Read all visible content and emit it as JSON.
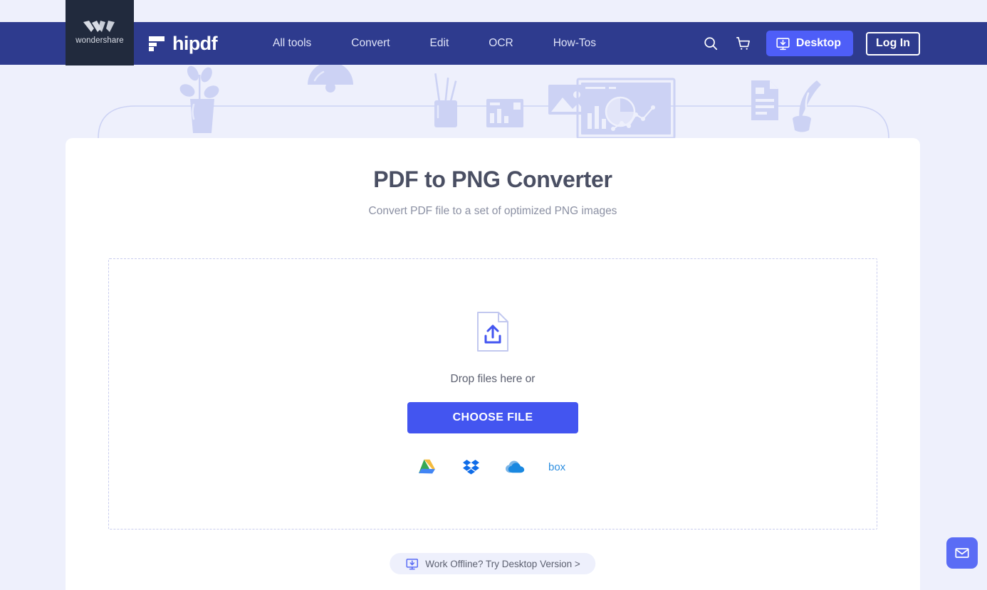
{
  "brand": {
    "corner_logo_text": "wondershare",
    "corner_logo_icon": "wondershare-w-icon",
    "product_name": "hipdf",
    "product_logo_icon": "hipdf-mark-icon"
  },
  "nav": {
    "links": [
      {
        "label": "All tools"
      },
      {
        "label": "Convert"
      },
      {
        "label": "Edit"
      },
      {
        "label": "OCR"
      },
      {
        "label": "How-Tos"
      }
    ],
    "search_icon": "search-icon",
    "cart_icon": "shopping-cart-icon",
    "desktop_button": {
      "label": "Desktop",
      "icon": "monitor-download-icon"
    },
    "login_button": {
      "label": "Log In"
    }
  },
  "main": {
    "title": "PDF to PNG Converter",
    "subtitle": "Convert PDF file to a set of optimized PNG images",
    "dropzone": {
      "icon": "file-upload-icon",
      "drop_text": "Drop files here or",
      "choose_file_label": "CHOOSE FILE",
      "cloud_sources": [
        {
          "name": "google-drive-icon",
          "label": "Google Drive"
        },
        {
          "name": "dropbox-icon",
          "label": "Dropbox"
        },
        {
          "name": "onedrive-icon",
          "label": "OneDrive"
        },
        {
          "name": "box-icon",
          "label": "Box"
        }
      ]
    },
    "offline_pill": {
      "icon": "monitor-download-icon",
      "label": "Work Offline? Try Desktop Version >"
    }
  },
  "floating": {
    "mail_button_icon": "envelope-icon"
  },
  "colors": {
    "page_background": "#eef0fc",
    "navbar": "#2e3b8e",
    "corner_block": "#212a3d",
    "primary_button": "#4355f0",
    "desktop_button": "#4e5ef8",
    "mail_fab": "#5a6cf5",
    "title_text": "#4a4f63",
    "subtitle_text": "#8b90a3",
    "dropzone_border": "#c8ccee",
    "illustration": "#c9cff2"
  }
}
